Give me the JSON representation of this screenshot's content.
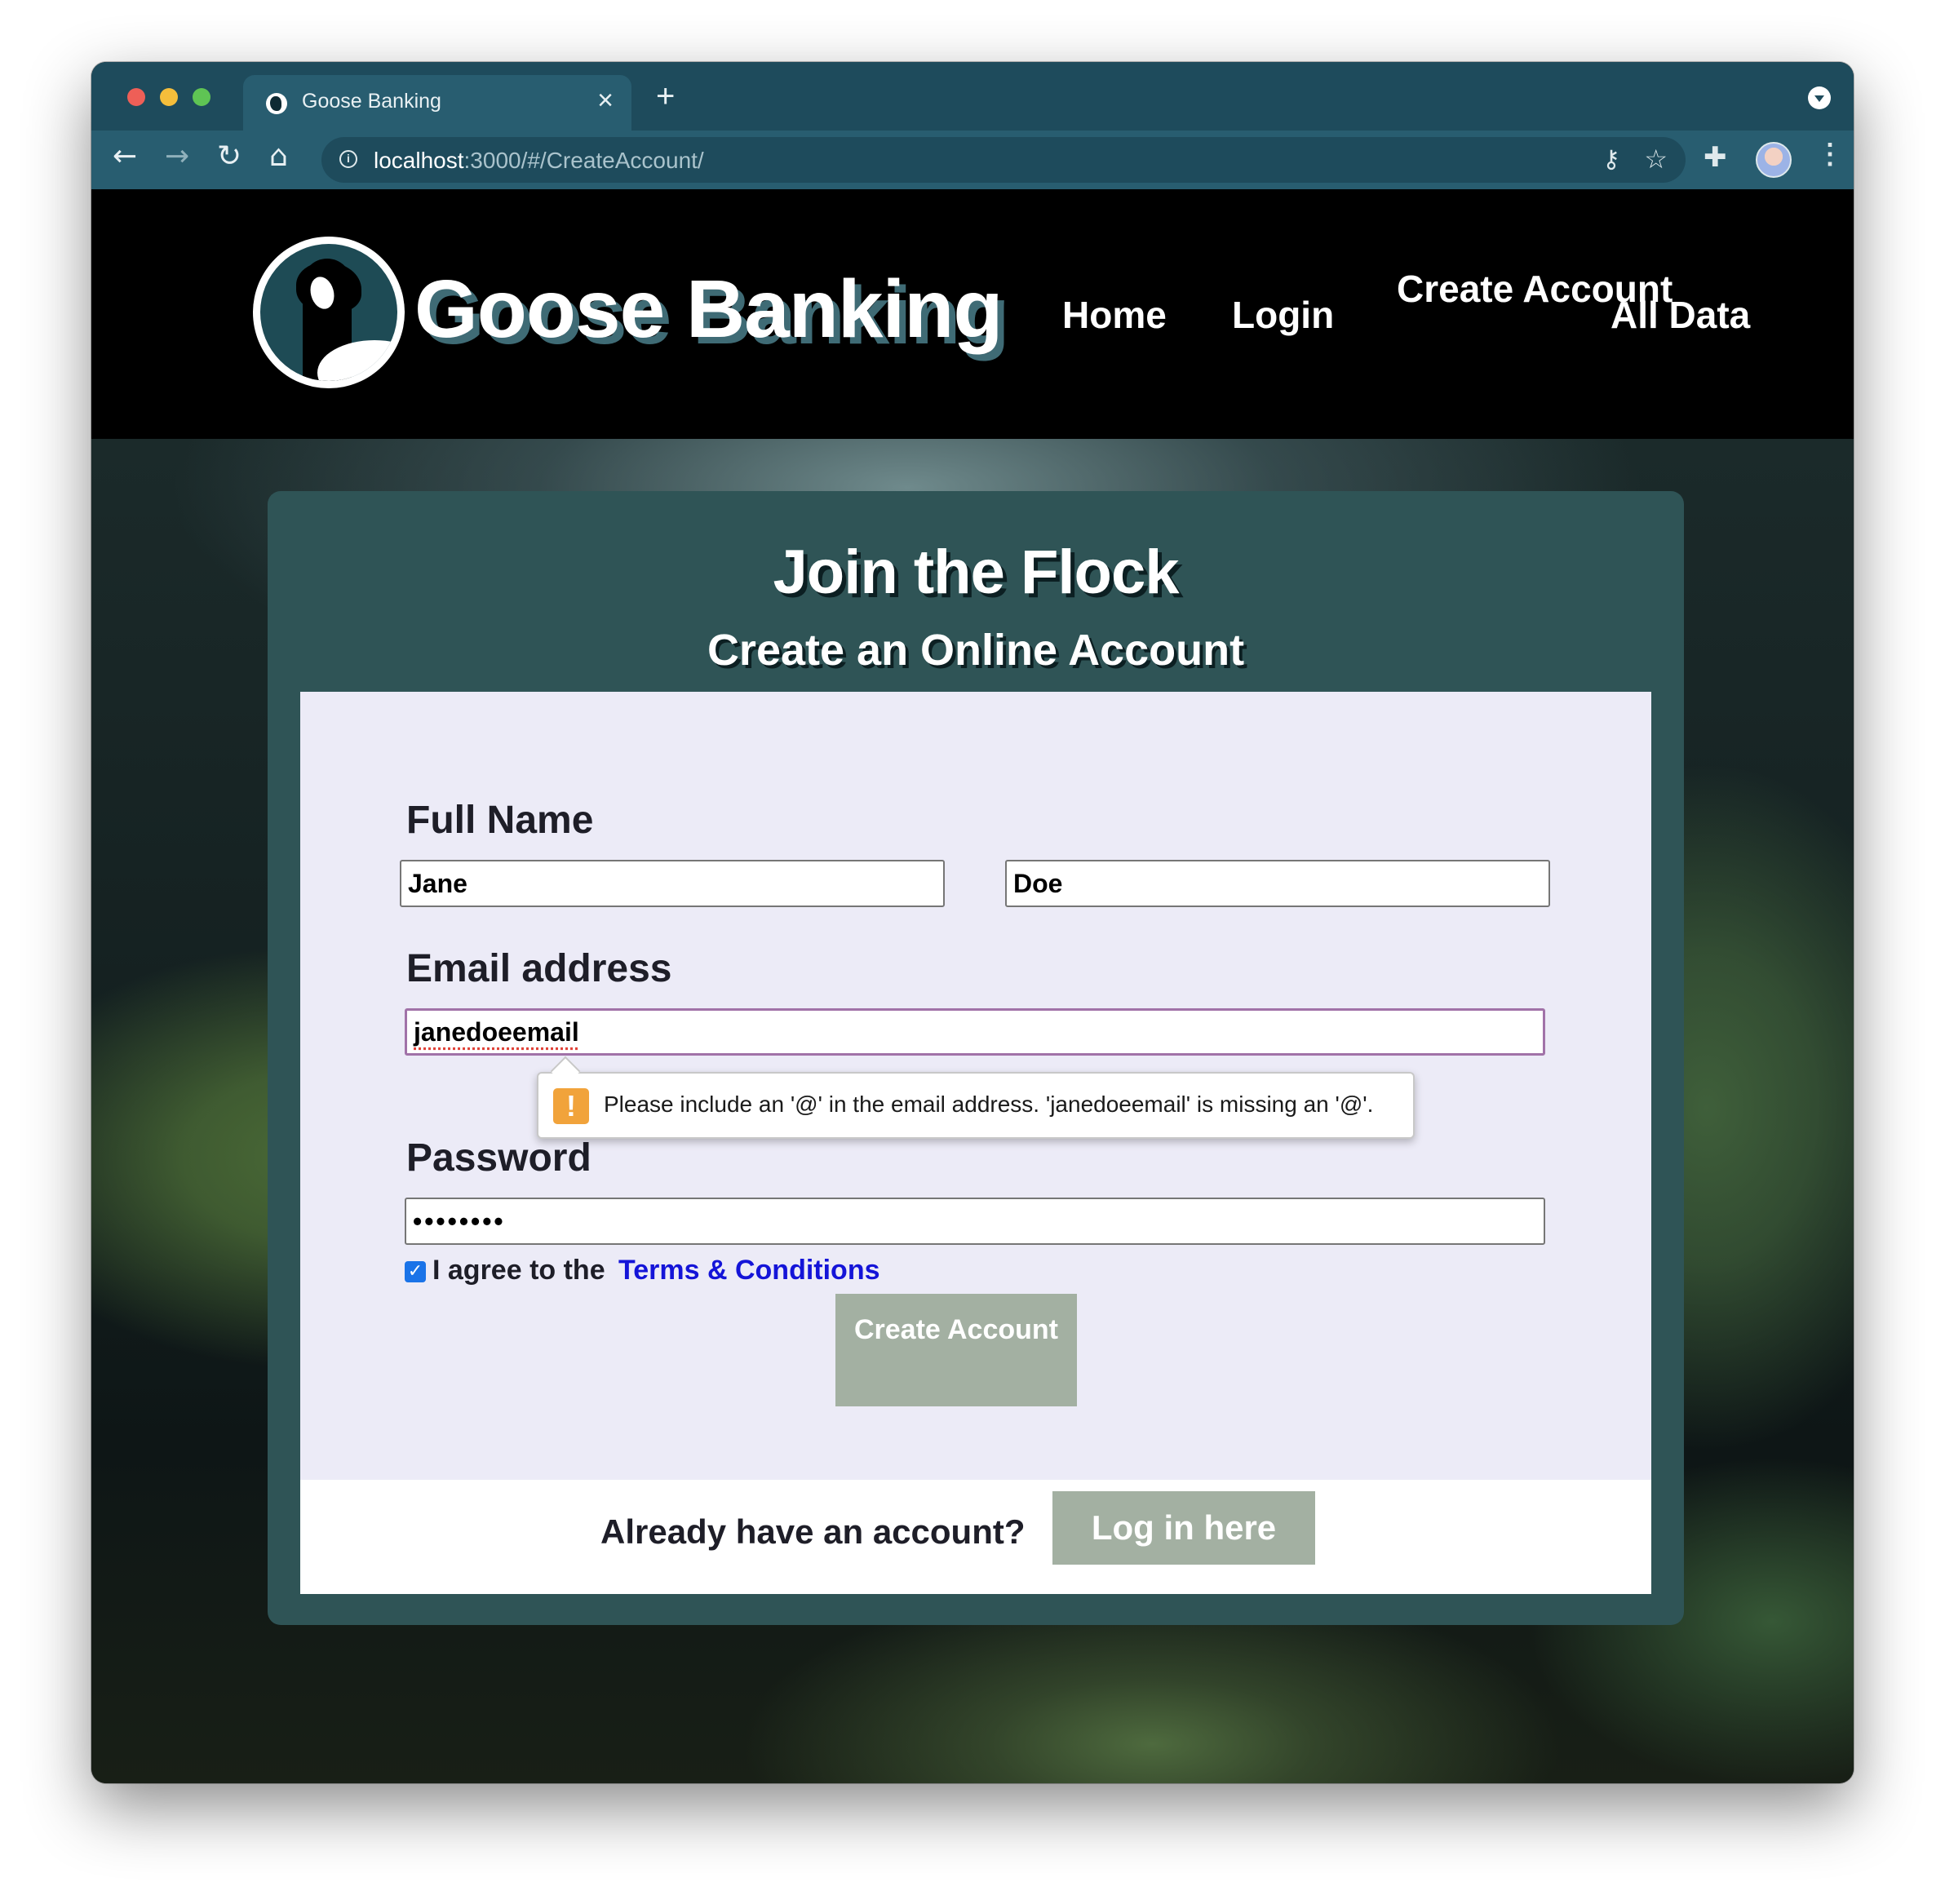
{
  "browser": {
    "tab_title": "Goose Banking",
    "tab_close": "×",
    "new_tab": "+",
    "url_host": "localhost",
    "url_rest": ":3000/#/CreateAccount/",
    "icons": [
      "back-arrow-icon",
      "forward-arrow-icon",
      "reload-icon",
      "home-icon",
      "info-icon",
      "key-icon",
      "star-icon",
      "extensions-icon",
      "menu-icon"
    ]
  },
  "header": {
    "brand": "Goose Banking",
    "nav": {
      "home": "Home",
      "login": "Login",
      "create_account": "Create Account",
      "all_data": "All Data"
    }
  },
  "card": {
    "title": "Join the Flock",
    "subtitle": "Create an Online Account"
  },
  "form": {
    "full_name_label": "Full Name",
    "first_name_value": "Jane",
    "last_name_value": "Doe",
    "email_label": "Email address",
    "email_value": "janedoeemail",
    "validation_message": "Please include an '@' in the email address. 'janedoeemail' is missing an '@'.",
    "password_label": "Password",
    "password_value": "••••••••",
    "agree_text": "I agree to the",
    "terms_link": "Terms & Conditions",
    "agree_checked": true,
    "submit_label": "Create Account"
  },
  "footer": {
    "prompt": "Already have an account?",
    "login_button": "Log in here"
  },
  "colors": {
    "tab_bar": "#1e4b5c",
    "card": "#2f5456",
    "panel": "#ecebf7",
    "button": "#a3b0a2",
    "link": "#1414d8",
    "warning": "#f1a33b"
  }
}
